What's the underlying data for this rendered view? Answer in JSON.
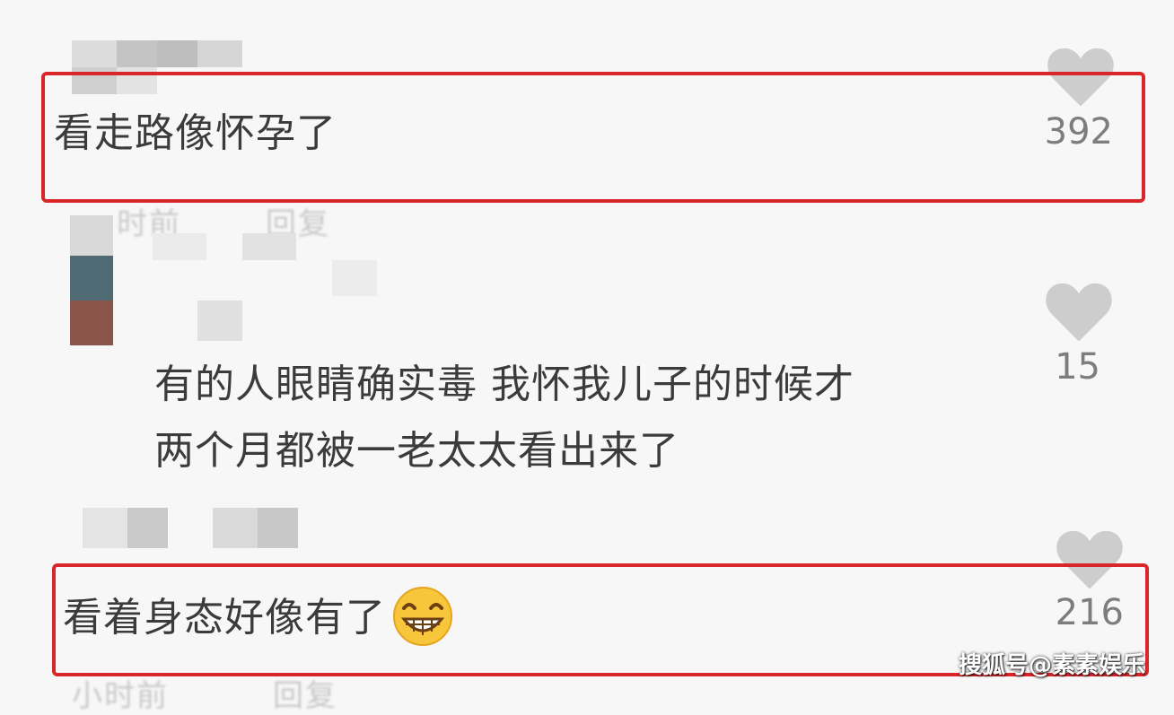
{
  "comments": [
    {
      "text": "看走路像怀孕了",
      "likes": "392"
    },
    {
      "line1": "有的人眼睛确实毒 我怀我儿子的时候才",
      "line2": "两个月都被一老太太看出来了",
      "likes": "15"
    },
    {
      "text": "看着身态好像有了",
      "likes": "216"
    }
  ],
  "meta_row": {
    "time": "时前",
    "reply": "回复"
  },
  "meta_row_bottom": {
    "time": "小时前",
    "reply": "回复"
  },
  "icons": {
    "like": "heart-icon",
    "emoji": "grinning-face-icon"
  },
  "colors": {
    "highlight": "#d8262a",
    "heart": "#c8c8c8",
    "text": "#3b3b3b"
  },
  "watermark": "搜狐号@素素娱乐"
}
